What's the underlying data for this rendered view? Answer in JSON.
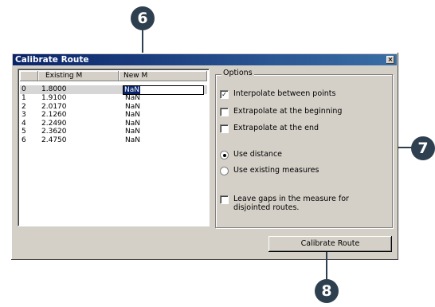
{
  "window": {
    "title": "Calibrate Route",
    "close_glyph": "×"
  },
  "list": {
    "columns": [
      "",
      "Existing M",
      "New M"
    ],
    "rows": [
      {
        "id": "0",
        "existing": "1.8000",
        "new": "NaN"
      },
      {
        "id": "1",
        "existing": "1.9100",
        "new": "NaN"
      },
      {
        "id": "2",
        "existing": "2.0170",
        "new": "NaN"
      },
      {
        "id": "3",
        "existing": "2.1260",
        "new": "NaN"
      },
      {
        "id": "4",
        "existing": "2.2490",
        "new": "NaN"
      },
      {
        "id": "5",
        "existing": "2.3620",
        "new": "NaN"
      },
      {
        "id": "6",
        "existing": "2.4750",
        "new": "NaN"
      }
    ],
    "selected_row": 0
  },
  "options": {
    "legend": "Options",
    "interpolate": {
      "label": "Interpolate between points",
      "checked": true
    },
    "extrap_begin": {
      "label": "Extrapolate at the beginning",
      "checked": false
    },
    "extrap_end": {
      "label": "Extrapolate at the end",
      "checked": false
    },
    "use_distance": {
      "label": "Use distance",
      "selected": true
    },
    "use_existing": {
      "label": "Use existing measures",
      "selected": false
    },
    "leave_gaps": {
      "label": "Leave gaps in the measure for disjointed routes.",
      "checked": false
    }
  },
  "buttons": {
    "calibrate": "Calibrate Route"
  },
  "callouts": {
    "c6": "6",
    "c7": "7",
    "c8": "8"
  },
  "colors": {
    "callout": "#2e3f4f",
    "titlebar": "#0a246a",
    "dialog": "#d4d0c8"
  }
}
